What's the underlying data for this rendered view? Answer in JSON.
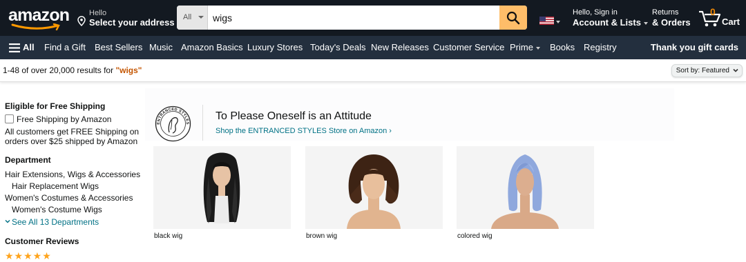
{
  "header": {
    "logo_text": "amazon",
    "address": {
      "line1": "Hello",
      "line2": "Select your address",
      "icon": "location-pin-icon"
    },
    "search": {
      "category": "All",
      "query": "wigs",
      "button_icon": "search-icon"
    },
    "account": {
      "line1": "Hello, Sign in",
      "line2": "Account & Lists"
    },
    "orders": {
      "line1": "Returns",
      "line2": "& Orders"
    },
    "cart": {
      "count": "0",
      "label": "Cart"
    },
    "colors": {
      "topbar": "#131921",
      "navbar": "#232f3e",
      "search_button": "#febd69",
      "cart_count": "#f08804"
    }
  },
  "nav": {
    "all_label": "All",
    "items": [
      "Find a Gift",
      "Best Sellers",
      "Music",
      "Amazon Basics",
      "Luxury Stores",
      "Today's Deals",
      "New Releases",
      "Customer Service",
      "Prime",
      "Books",
      "Registry"
    ],
    "promo": "Thank you gift cards"
  },
  "results": {
    "prefix": "1-48 of over 20,000 results for ",
    "term": "\"wigs\"",
    "sort_label": "Sort by:",
    "sort_value": "Featured"
  },
  "sidebar": {
    "shipping": {
      "heading": "Eligible for Free Shipping",
      "checkbox_label": "Free Shipping by Amazon",
      "note_line1": "All customers get FREE Shipping on",
      "note_line2": "orders over $25 shipped by Amazon"
    },
    "department": {
      "heading": "Department",
      "items": [
        "Hair Extensions, Wigs & Accessories",
        "Hair Replacement Wigs",
        "Women's Costumes & Accessories",
        "Women's Costume Wigs"
      ],
      "see_all": "See All 13 Departments"
    },
    "reviews": {
      "heading": "Customer Reviews"
    }
  },
  "brand": {
    "logo_text": "ENTRANCED STYLES",
    "title": "To Please Oneself is an Attitude",
    "link": "Shop the ENTRANCED STYLES Store on Amazon ›"
  },
  "tiles": [
    {
      "label": "black wig"
    },
    {
      "label": "brown wig"
    },
    {
      "label": "colored wig"
    }
  ]
}
